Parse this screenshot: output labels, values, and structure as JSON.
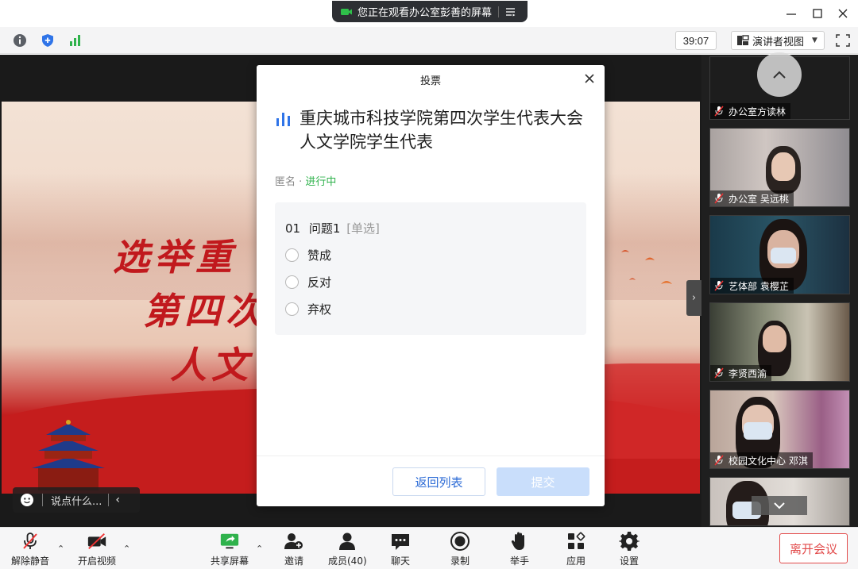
{
  "share_banner": {
    "text": "您正在观看办公室彭善的屏幕"
  },
  "topbar": {
    "timer": "39:07",
    "view_mode": "演讲者视图"
  },
  "slide": {
    "line1": "选举重",
    "line2": "第四次",
    "line3": "人文",
    "chat_placeholder": "说点什么..."
  },
  "vote": {
    "dialog_title": "投票",
    "heading": "重庆城市科技学院第四次学生代表大会人文学院学生代表",
    "anonymous": "匿名",
    "dot": " · ",
    "status": "进行中",
    "question": {
      "number": "01",
      "title": "问题1",
      "type": "[单选]"
    },
    "options": [
      "赞成",
      "反对",
      "弃权"
    ],
    "back_label": "返回列表",
    "submit_label": "提交"
  },
  "participants": [
    {
      "name": "办公室方读林"
    },
    {
      "name": "办公室 吴远桃"
    },
    {
      "name": "艺体部 袁樱芷"
    },
    {
      "name": "李贤西渝"
    },
    {
      "name": "校园文化中心 邓淇"
    }
  ],
  "bottombar": {
    "mute": "解除静音",
    "video": "开启视频",
    "share": "共享屏幕",
    "invite": "邀请",
    "members": "成员(40)",
    "chat": "聊天",
    "record": "录制",
    "hand": "举手",
    "apps": "应用",
    "settings": "设置",
    "leave": "离开会议"
  },
  "colors": {
    "accent_blue": "#2c6bd6",
    "status_green": "#2fb24c",
    "leave_red": "#e24a4a",
    "slide_red": "#c1191d"
  }
}
